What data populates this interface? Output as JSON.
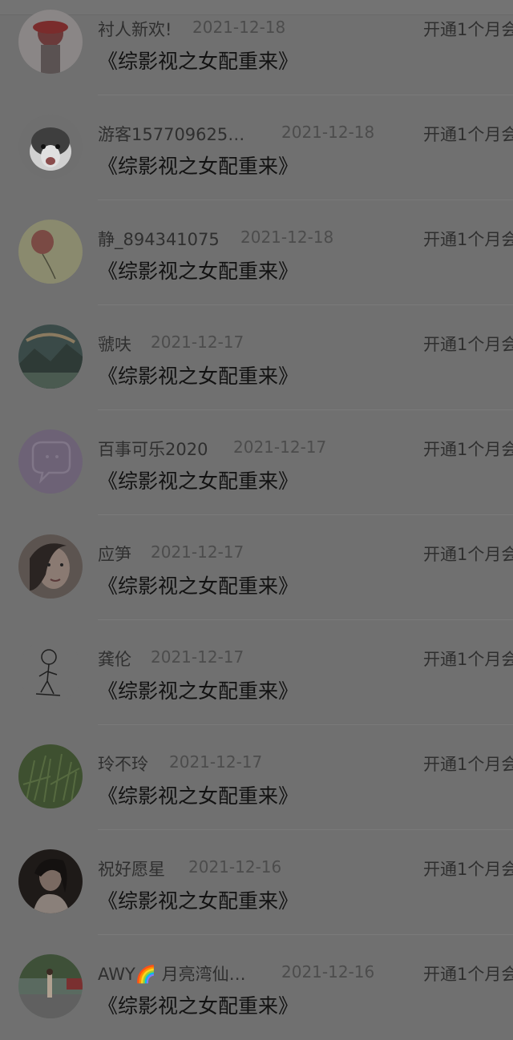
{
  "items": [
    {
      "name": "衬人新欢!",
      "date": "2021-12-18",
      "book": "《综影视之女配重来》",
      "action": "开通1个月会",
      "avatar_icon": "avatar-girl-red-hat"
    },
    {
      "name": "游客157709625…",
      "date": "2021-12-18",
      "book": "《综影视之女配重来》",
      "action": "开通1个月会",
      "avatar_icon": "avatar-husky-dog"
    },
    {
      "name": "静_894341075",
      "date": "2021-12-18",
      "book": "《综影视之女配重来》",
      "action": "开通1个月会",
      "avatar_icon": "avatar-balloon-drawing"
    },
    {
      "name": "虢呋",
      "date": "2021-12-17",
      "book": "《综影视之女配重来》",
      "action": "开通1个月会",
      "avatar_icon": "avatar-landscape-painting"
    },
    {
      "name": "百事可乐2020",
      "date": "2021-12-17",
      "book": "《综影视之女配重来》",
      "action": "开通1个月会",
      "avatar_icon": "avatar-purple-chat-bubble"
    },
    {
      "name": "应笋",
      "date": "2021-12-17",
      "book": "《综影视之女配重来》",
      "action": "开通1个月会",
      "avatar_icon": "avatar-woman-portrait"
    },
    {
      "name": "龚伦",
      "date": "2021-12-17",
      "book": "《综影视之女配重来》",
      "action": "开通1个月会",
      "avatar_icon": "avatar-sketch-figure"
    },
    {
      "name": "玲不玲",
      "date": "2021-12-17",
      "book": "《综影视之女配重来》",
      "action": "开通1个月会",
      "avatar_icon": "avatar-green-grass"
    },
    {
      "name": "祝好愿星",
      "date": "2021-12-16",
      "book": "《综影视之女配重来》",
      "action": "开通1个月会",
      "avatar_icon": "avatar-girl-dark-portrait"
    },
    {
      "name": "AWY🌈 月亮湾仙…",
      "date": "2021-12-16",
      "book": "《综影视之女配重来》",
      "action": "开通1个月会",
      "avatar_icon": "avatar-street-photo"
    }
  ],
  "colors": {
    "overlay_bg": "#707070",
    "name_text": "#2f2f2f",
    "date_text": "#4c4c4c",
    "book_text": "#121212"
  }
}
